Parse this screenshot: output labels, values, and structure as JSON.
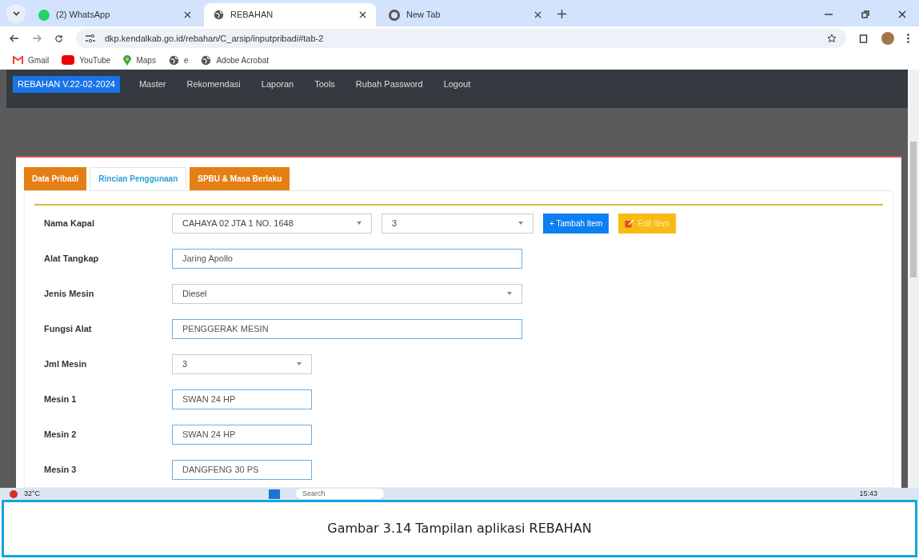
{
  "browser": {
    "tabs": [
      {
        "title": "(2) WhatsApp",
        "selected": false
      },
      {
        "title": "REBAHAN",
        "selected": true
      },
      {
        "title": "New Tab",
        "selected": false
      }
    ],
    "url": "dkp.kendalkab.go.id/rebahan/C_arsip/inputpribadi#tab-2",
    "bookmarks": [
      "Gmail",
      "YouTube",
      "Maps",
      "e",
      "Adobe Acrobat"
    ]
  },
  "app": {
    "brand": "REBAHAN V.22-02-2024",
    "menu": [
      "Master",
      "Rekomendasi",
      "Laporan",
      "Tools",
      "Rubah Password",
      "Logout"
    ],
    "tabs": [
      {
        "label": "Data Pribadi",
        "selected": false
      },
      {
        "label": "Rincian Penggunaan",
        "selected": true
      },
      {
        "label": "SPBU & Masa Berlaku",
        "selected": false
      }
    ],
    "rows": [
      {
        "label": "Nama Kapal",
        "fields": [
          {
            "kind": "select",
            "value": "CAHAYA 02 JTA 1 NO. 1648"
          },
          {
            "kind": "select",
            "value": "3"
          }
        ],
        "buttons": [
          "+ Tambah Item",
          "Edit Item"
        ]
      },
      {
        "label": "Alat Tangkap",
        "fields": [
          {
            "kind": "input",
            "value": "Jaring Apollo"
          }
        ]
      },
      {
        "label": "Jenis Mesin",
        "fields": [
          {
            "kind": "select",
            "value": "Diesel"
          }
        ]
      },
      {
        "label": "Fungsi Alat",
        "fields": [
          {
            "kind": "input",
            "value": "PENGGERAK MESIN"
          }
        ]
      },
      {
        "label": "Jml Mesin",
        "fields": [
          {
            "kind": "select",
            "value": "3"
          }
        ]
      },
      {
        "label": "Mesin 1",
        "fields": [
          {
            "kind": "input",
            "value": "SWAN 24 HP"
          }
        ]
      },
      {
        "label": "Mesin 2",
        "fields": [
          {
            "kind": "input",
            "value": "SWAN 24 HP"
          }
        ]
      },
      {
        "label": "Mesin 3",
        "fields": [
          {
            "kind": "input",
            "value": "DANGFENG 30 PS"
          }
        ]
      }
    ]
  },
  "taskbar": {
    "weather": "32°C",
    "search": "Search",
    "clock": "15:43"
  },
  "caption": "Gambar 3.14 Tampilan aplikasi REBAHAN"
}
